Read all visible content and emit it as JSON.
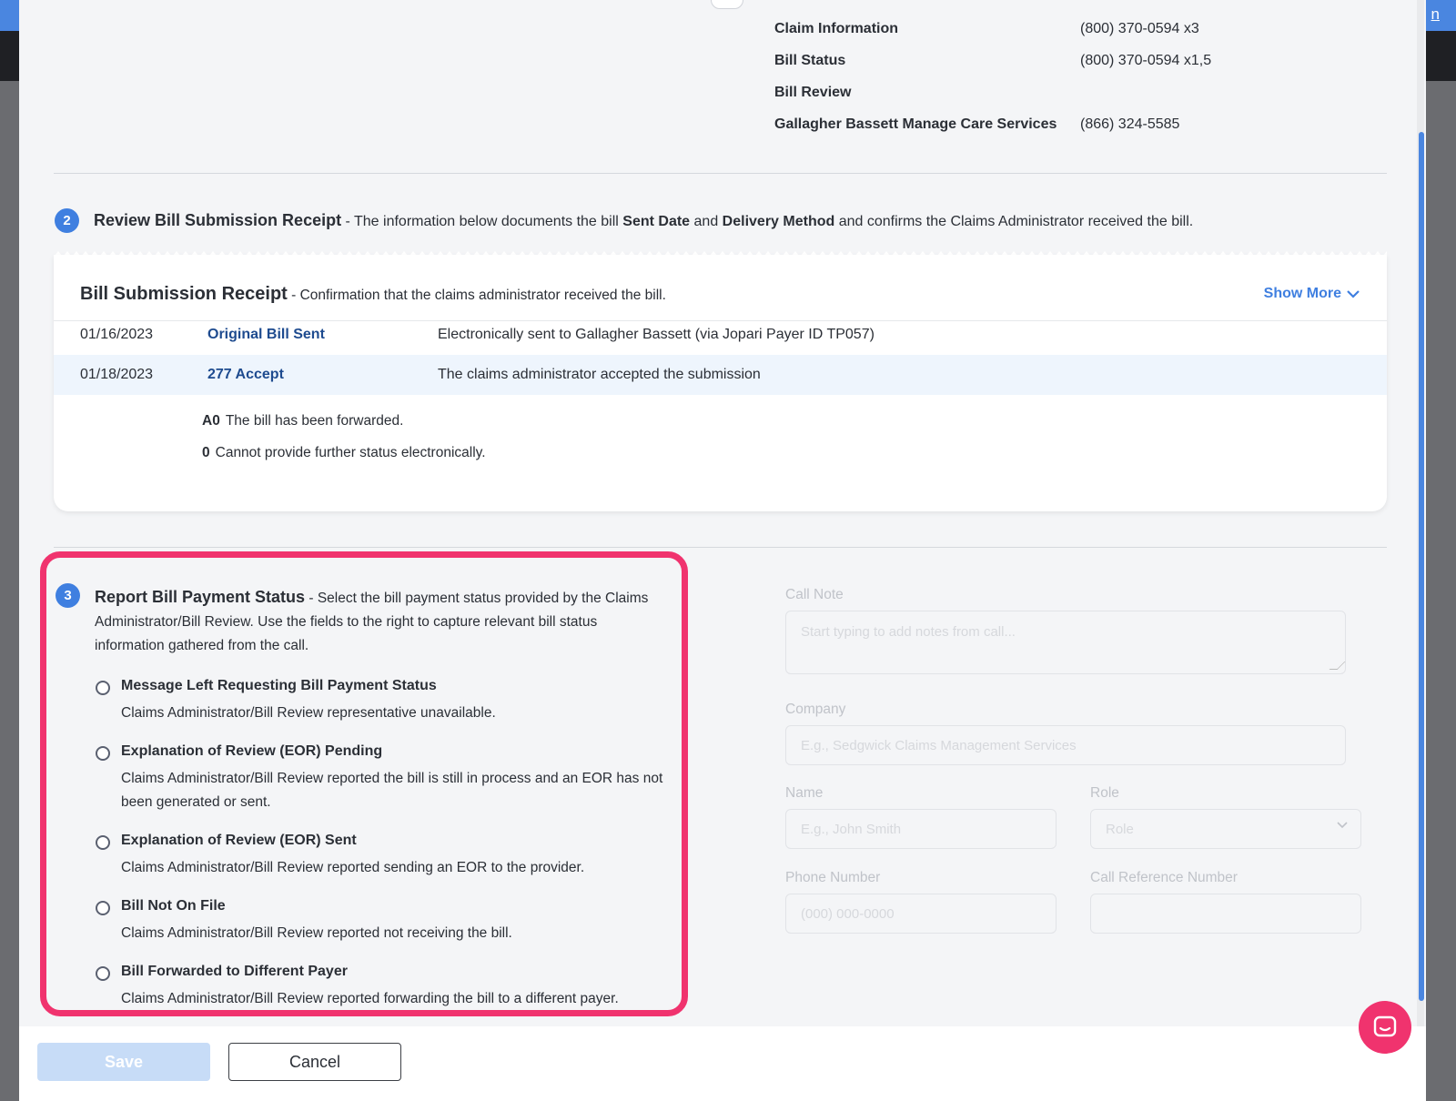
{
  "backdrop": {
    "link_text": "n"
  },
  "contacts": [
    {
      "label": "Claim Information",
      "value": "(800) 370-0594 x3"
    },
    {
      "label": "Bill Status",
      "value": "(800) 370-0594 x1,5"
    },
    {
      "label": "Bill Review",
      "value": ""
    },
    {
      "label": "Gallagher Bassett Manage Care Services",
      "value": "(866) 324-5585"
    }
  ],
  "step2": {
    "number": "2",
    "title": "Review Bill Submission Receipt",
    "text_1": " - The information below documents the bill ",
    "bold_1": "Sent Date",
    "text_2": " and ",
    "bold_2": "Delivery Method",
    "text_3": " and confirms the Claims Administrator received the bill."
  },
  "receipt": {
    "title": "Bill Submission Receipt",
    "subtitle": " - Confirmation that the claims administrator received the bill.",
    "show_more": "Show More",
    "rows": [
      {
        "date": "01/16/2023",
        "type": "Original Bill Sent",
        "desc": "Electronically sent to Gallagher Bassett (via Jopari Payer ID TP057)"
      },
      {
        "date": "01/18/2023",
        "type": "277 Accept",
        "desc": "The claims administrator accepted the submission"
      }
    ],
    "codes": [
      {
        "code": "A0",
        "text": "The bill has been forwarded."
      },
      {
        "code": "0",
        "text": "Cannot provide further status electronically."
      }
    ]
  },
  "step3": {
    "number": "3",
    "title": "Report Bill Payment Status",
    "text": " - Select the bill payment status provided by the Claims Administrator/Bill Review. Use the fields to the right to capture relevant bill status information gathered from the call.",
    "options": [
      {
        "title": "Message Left Requesting Bill Payment Status",
        "desc": "Claims Administrator/Bill Review representative unavailable."
      },
      {
        "title": "Explanation of Review (EOR) Pending",
        "desc": "Claims Administrator/Bill Review reported the bill is still in process and an EOR has not been generated or sent."
      },
      {
        "title": "Explanation of Review (EOR) Sent",
        "desc": "Claims Administrator/Bill Review reported sending an EOR to the provider."
      },
      {
        "title": "Bill Not On File",
        "desc": "Claims Administrator/Bill Review reported not receiving the bill."
      },
      {
        "title": "Bill Forwarded to Different Payer",
        "desc": "Claims Administrator/Bill Review reported forwarding the bill to a different payer."
      }
    ]
  },
  "form": {
    "call_note": {
      "label": "Call Note",
      "placeholder": "Start typing to add notes from call..."
    },
    "company": {
      "label": "Company",
      "placeholder": "E.g., Sedgwick Claims Management Services"
    },
    "name": {
      "label": "Name",
      "placeholder": "E.g., John Smith"
    },
    "role": {
      "label": "Role",
      "placeholder": "Role"
    },
    "phone": {
      "label": "Phone Number",
      "placeholder": "(000) 000-0000"
    },
    "call_ref": {
      "label": "Call Reference Number",
      "placeholder": ""
    }
  },
  "footer": {
    "save_label": "Save",
    "cancel_label": "Cancel"
  },
  "colors": {
    "accent": "#3f7fe0",
    "highlight": "#f0336e",
    "link_dark": "#1e4b8f"
  },
  "icons": {
    "show_more": "chevron-down-icon",
    "chat": "chat-icon",
    "select": "chevron-down-icon"
  }
}
